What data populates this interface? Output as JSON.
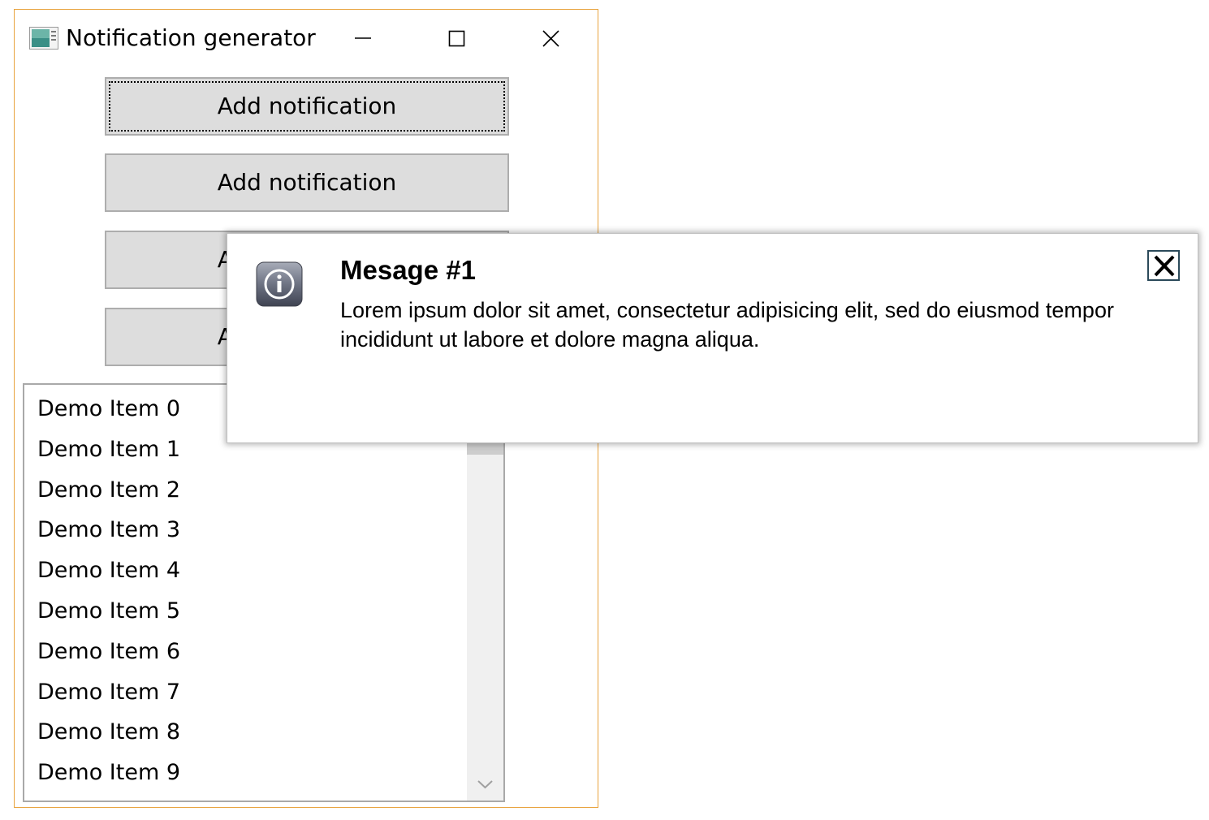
{
  "window": {
    "title": "Notification generator",
    "accent_border": "#e8a33d",
    "controls": {
      "minimize": "minimize-icon",
      "maximize": "maximize-icon",
      "close": "close-icon"
    }
  },
  "buttons": [
    {
      "label": "Add notification"
    },
    {
      "label": "Add notification"
    },
    {
      "label": "Add notification"
    },
    {
      "label": "Add notification"
    }
  ],
  "list": {
    "items": [
      "Demo Item 0",
      "Demo Item 1",
      "Demo Item 2",
      "Demo Item 3",
      "Demo Item 4",
      "Demo Item 5",
      "Demo Item 6",
      "Demo Item 7",
      "Demo Item 8",
      "Demo Item 9"
    ]
  },
  "notification": {
    "icon": "info-icon",
    "title": "Mesage #1",
    "body": "Lorem ipsum dolor sit amet, consectetur adipisicing elit, sed do eiusmod tempor incididunt ut labore et dolore magna aliqua.",
    "close_icon": "close-icon"
  }
}
